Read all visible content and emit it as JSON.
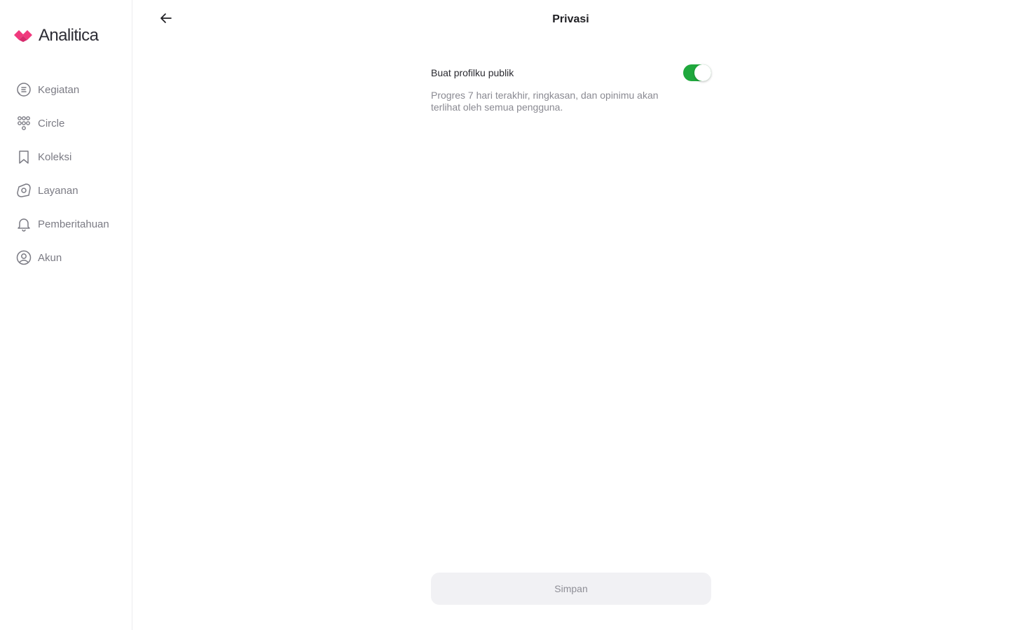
{
  "app": {
    "name": "Analitica",
    "brand_color": "#f0397d"
  },
  "sidebar": {
    "items": [
      {
        "label": "Kegiatan",
        "icon": "activity-icon"
      },
      {
        "label": "Circle",
        "icon": "people-icon"
      },
      {
        "label": "Koleksi",
        "icon": "bookmark-icon"
      },
      {
        "label": "Layanan",
        "icon": "services-icon"
      },
      {
        "label": "Pemberitahuan",
        "icon": "bell-icon"
      },
      {
        "label": "Akun",
        "icon": "account-icon"
      }
    ]
  },
  "header": {
    "title": "Privasi",
    "back_icon": "arrow-left-icon"
  },
  "privacy": {
    "public_profile_label": "Buat profilku publik",
    "public_profile_enabled": true,
    "public_profile_description": "Progres 7 hari terakhir, ringkasan, dan opinimu akan terlihat oleh semua pengguna.",
    "toggle_color": "#1fa83d"
  },
  "footer": {
    "save_label": "Simpan"
  }
}
